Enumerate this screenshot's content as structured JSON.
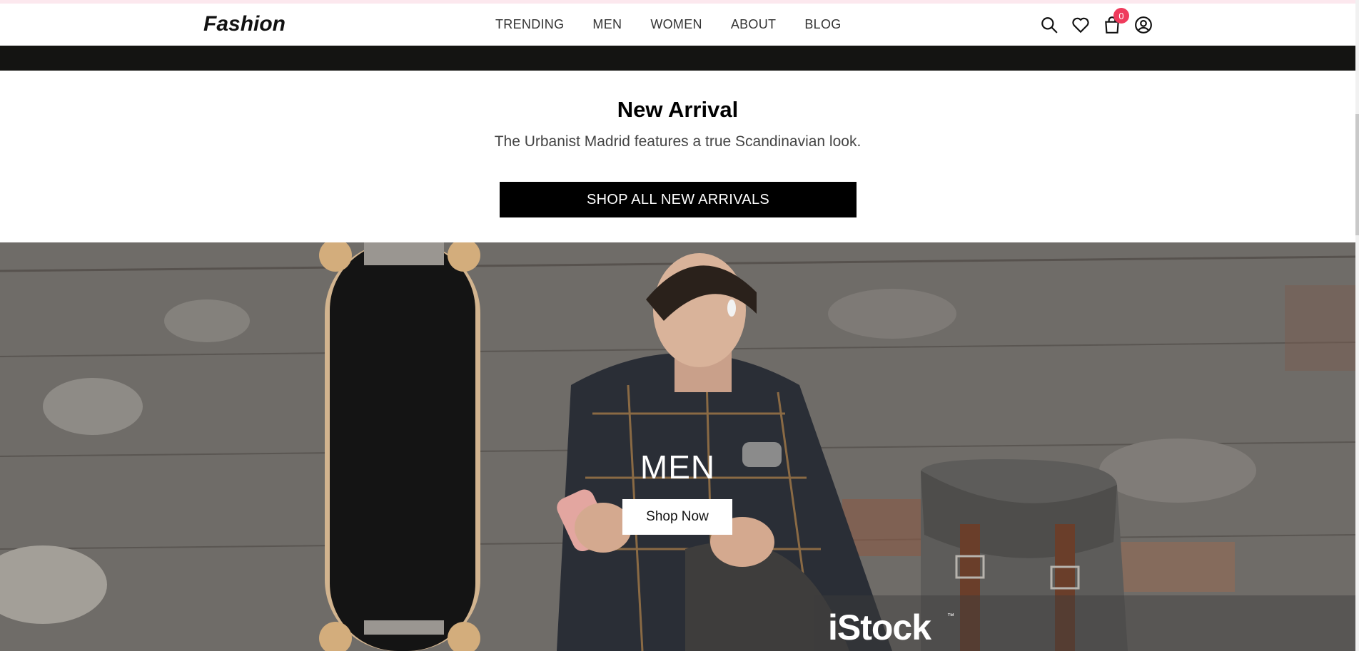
{
  "header": {
    "brand": "Fashion",
    "nav": [
      "TRENDING",
      "MEN",
      "WOMEN",
      "ABOUT",
      "BLOG"
    ],
    "icons": [
      "search-icon",
      "heart-icon",
      "cart-icon",
      "user-icon"
    ],
    "cart_count": "0",
    "badge_color": "#ef3b5c"
  },
  "arrival": {
    "title": "New Arrival",
    "subtitle": "The Urbanist Madrid features a true Scandinavian look.",
    "cta": "SHOP ALL NEW ARRIVALS"
  },
  "hero": {
    "title": "MEN",
    "button": "Shop Now",
    "watermark": "iStock",
    "watermark_tm": "™"
  }
}
